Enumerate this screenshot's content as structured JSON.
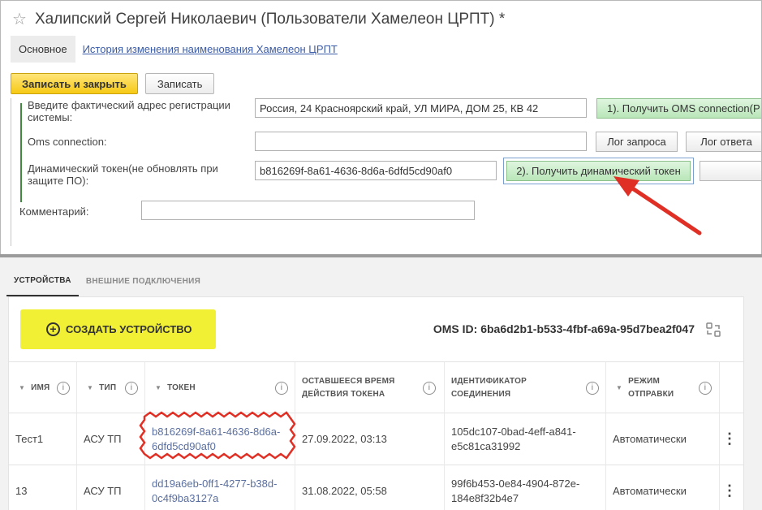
{
  "window": {
    "title": "Халипский Сергей Николаевич (Пользователи Хамелеон ЦРПТ) *",
    "tab_main": "Основное",
    "tab_history": "История изменения наименования Хамелеон ЦРПТ",
    "save_close": "Записать и закрыть",
    "save": "Записать"
  },
  "form": {
    "address_label": "Введите фактический адрес регистрации системы:",
    "address_value": "Россия, 24 Красноярский край, УЛ МИРА, ДОМ 25, КВ 42",
    "get_oms_button": "1). Получить OMS connection(Р",
    "oms_label": "Oms connection:",
    "oms_value": "",
    "log_request": "Лог запроса",
    "log_response": "Лог ответа",
    "token_label": "Динамический токен(не обновлять при защите ПО):",
    "token_value": "b816269f-8a61-4636-8d6a-6dfd5cd90af0",
    "get_token_button": "2). Получить динамический токен",
    "comment_label": "Комментарий:",
    "comment_value": ""
  },
  "app": {
    "tabs": [
      {
        "label": "УСТРОЙСТВА",
        "active": true
      },
      {
        "label": "ВНЕШНИЕ ПОДКЛЮЧЕНИЯ",
        "active": false
      }
    ],
    "create_button": "СОЗДАТЬ УСТРОЙСТВО",
    "oms_id": "OMS ID: 6ba6d2b1-b533-4fbf-a69a-95d7bea2f047",
    "columns": {
      "name": "ИМЯ",
      "type": "ТИП",
      "token": "ТОКЕН",
      "remaining_1": "ОСТАВШЕЕСЯ ВРЕМЯ",
      "remaining_2": "ДЕЙСТВИЯ ТОКЕНА",
      "conn_1": "ИДЕНТИФИКАТОР",
      "conn_2": "СОЕДИНЕНИЯ",
      "mode_1": "РЕЖИМ",
      "mode_2": "ОТПРАВКИ"
    },
    "rows": [
      {
        "name": "Тест1",
        "type": "АСУ ТП",
        "token_1": "b816269f-8a61-4636-8d6a-",
        "token_2": "6dfd5cd90af0",
        "remaining": "27.09.2022, 03:13",
        "conn_1": "105dc107-0bad-4eff-a841-",
        "conn_2": "e5c81ca31992",
        "mode": "Автоматически"
      },
      {
        "name": "13",
        "type": "АСУ ТП",
        "token_1": "dd19a6eb-0ff1-4277-b38d-",
        "token_2": "0c4f9ba3127a",
        "remaining": "31.08.2022, 05:58",
        "conn_1": "99f6b453-0e84-4904-872e-",
        "conn_2": "184e8f32b4e7",
        "mode": "Автоматически"
      }
    ]
  },
  "colors": {
    "accent_yellow": "#f2f035",
    "primary_button": "#f6c915",
    "green_button": "#b9e6b9",
    "annotation_red": "#e03025",
    "link": "#3a5ba8"
  }
}
